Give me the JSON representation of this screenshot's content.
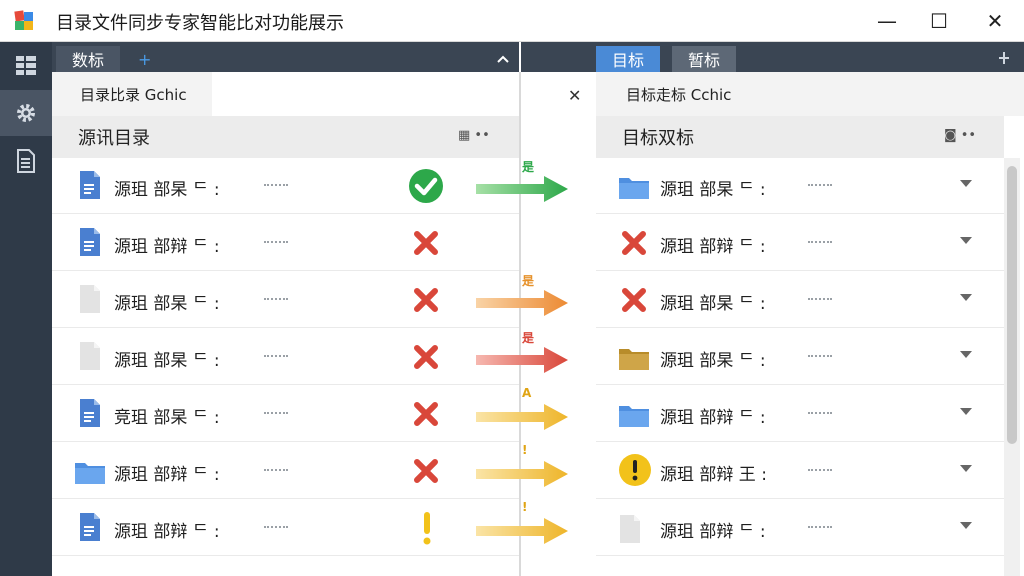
{
  "window": {
    "title": "目录文件同步专家智能比对功能展示",
    "minimize": "—",
    "maximize": "☐",
    "close": "✕"
  },
  "sidebar": {
    "items": [
      {
        "icon": "dashboard-icon"
      },
      {
        "icon": "gear-icon",
        "active": true
      },
      {
        "icon": "document-list-icon"
      }
    ]
  },
  "left": {
    "tabs": [
      {
        "label": "数标",
        "active": true
      }
    ],
    "add_icon": "+",
    "collapse_icon": "chevron-up-icon",
    "subtab": "目录比录 Gchic",
    "close_icon": "✕",
    "header": "源讯目录",
    "header_actions": "▦ ••"
  },
  "right": {
    "tabs": [
      {
        "label": "目标",
        "active": true
      },
      {
        "label": "暂标",
        "active": false
      }
    ],
    "pin_icon": "pin-icon",
    "subtab": "目标走标 Cchic",
    "header": "目标双标",
    "header_actions": "◙ ••"
  },
  "rows": [
    {
      "left_icon": "doc-blue",
      "left_label": "源珇 部杲 ᄃ :",
      "status": "check",
      "arrow": "green",
      "arrow_label": "是",
      "right_icon": "folder-blue",
      "right_label": "源珇 部杲 ᄃ :"
    },
    {
      "left_icon": "doc-blue",
      "left_label": "源珇 部辩 ᄃ :",
      "status": "cross",
      "arrow": "none",
      "arrow_label": "",
      "right_icon": "cross",
      "right_label": "源珇 部辩 ᄃ :"
    },
    {
      "left_icon": "doc-grey",
      "left_label": "源珇 部杲 ᄃ :",
      "status": "cross",
      "arrow": "orange",
      "arrow_label": "是",
      "right_icon": "cross",
      "right_label": "源珇 部杲 ᄃ :"
    },
    {
      "left_icon": "doc-grey",
      "left_label": "源珇 部杲 ᄃ :",
      "status": "cross",
      "arrow": "red",
      "arrow_label": "是",
      "right_icon": "folder-gold",
      "right_label": "源珇 部杲 ᄃ :"
    },
    {
      "left_icon": "doc-blue",
      "left_label": "竞珇 部杲 ᄃ :",
      "status": "cross",
      "arrow": "yellow",
      "arrow_label": "A",
      "right_icon": "folder-blue",
      "right_label": "源珇 部辩 ᄃ :"
    },
    {
      "left_icon": "folder-blue",
      "left_label": "源珇 部辩 ᄃ :",
      "status": "cross",
      "arrow": "yellow",
      "arrow_label": "!",
      "right_icon": "warning",
      "right_label": "源珇 部辩 王 :"
    },
    {
      "left_icon": "doc-blue",
      "left_label": "源珇 部辩 ᄃ :",
      "status": "warn-bang",
      "arrow": "yellow-bang",
      "arrow_label": "!",
      "right_icon": "doc-grey",
      "right_label": "源珇 部辩 ᄃ :"
    }
  ],
  "colors": {
    "sidebar": "#2f3a48",
    "tab_active": "#4a8ad6",
    "check": "#2da84a",
    "cross": "#d9473a",
    "doc_blue": "#4a7fd0",
    "folder_blue": "#4f8fe0",
    "folder_gold": "#b88c2a",
    "warn": "#f2c21a"
  }
}
